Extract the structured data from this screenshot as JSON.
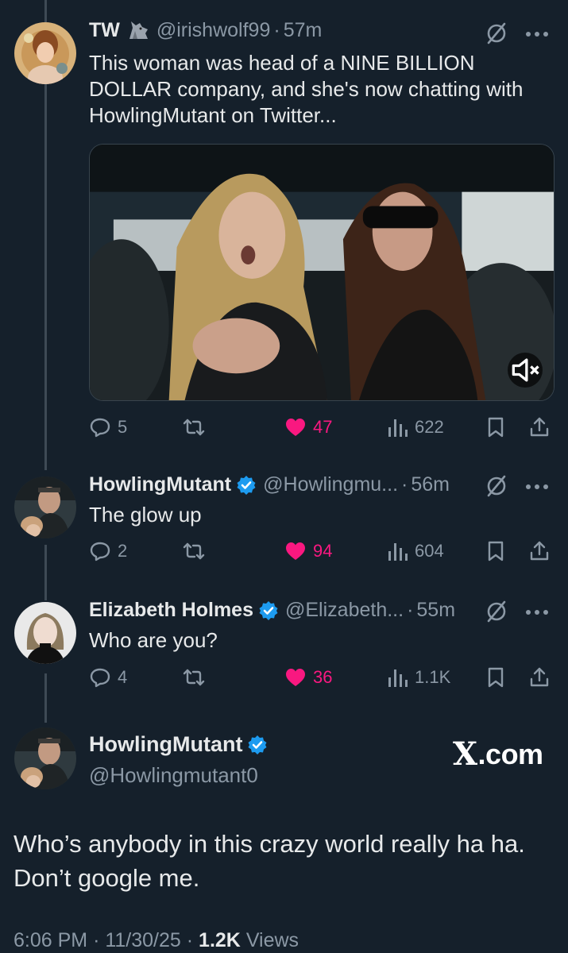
{
  "tweets": [
    {
      "name": "TW",
      "handle": "@irishwolf99",
      "time": "57m",
      "text": "This woman was head of a NINE BILLION DOLLAR company, and she's now chatting with HowlingMutant on Twitter...",
      "replies": "5",
      "likes": "47",
      "views": "622"
    },
    {
      "name": "HowlingMutant",
      "handle": "@Howlingmu...",
      "time": "56m",
      "text": "The glow up",
      "replies": "2",
      "likes": "94",
      "views": "604"
    },
    {
      "name": "Elizabeth Holmes",
      "handle": "@Elizabeth...",
      "time": "55m",
      "text": "Who are you?",
      "replies": "4",
      "likes": "36",
      "views": "1.1K"
    }
  ],
  "focus": {
    "name": "HowlingMutant",
    "handle": "@Howlingmutant0",
    "text": "Who’s anybody in this crazy world really ha ha. Don’t google me.",
    "time": "6:06 PM",
    "date": "11/30/25",
    "views_count": "1.2K",
    "views_label": "Views"
  },
  "watermark": {
    "x": "X",
    "rest": ".com"
  },
  "separators": {
    "dot": "·"
  },
  "icons": [
    "mute-icon",
    "more-icon",
    "reply-icon",
    "retweet-icon",
    "heart-icon",
    "views-icon",
    "bookmark-icon",
    "share-icon",
    "verified-icon",
    "sound-off-icon",
    "wolf-emoji-icon"
  ],
  "colors": {
    "background": "#15202b",
    "like": "#f91880",
    "verified": "#1d9bf0",
    "muted_text": "#8b98a5",
    "thread_line": "#3e4a55"
  }
}
